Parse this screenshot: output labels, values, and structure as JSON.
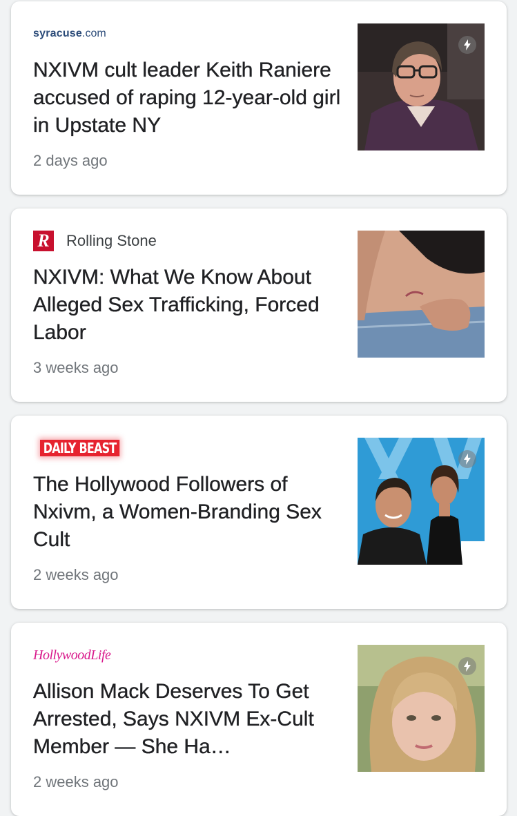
{
  "articles": [
    {
      "source": "syracuse",
      "source_suffix": ".com",
      "headline": "NXIVM cult leader Keith Raniere accused of raping 12-year-old girl in Upstate NY",
      "time": "2 days ago",
      "amp": true
    },
    {
      "logo_letter": "R",
      "source": "Rolling Stone",
      "headline": "NXIVM: What We Know About Alleged Sex Trafficking, Forced Labor",
      "time": "3 weeks ago",
      "amp": false
    },
    {
      "source": "DAILY BEAST",
      "headline": "The Hollywood Followers of Nxivm, a Women-Branding Sex Cult",
      "time": "2 weeks ago",
      "amp": true
    },
    {
      "source": "HollywoodLife",
      "headline": "Allison Mack Deserves To Get Arrested, Says NXIVM Ex-Cult Member — She Ha…",
      "time": "2 weeks ago",
      "amp": true
    }
  ],
  "colors": {
    "page_bg": "#f1f3f4",
    "headline": "#202124",
    "timestamp": "#70757a",
    "syracuse_logo": "#2a4a78",
    "rolling_stone_logo": "#c8102e",
    "daily_beast_logo": "#e6232f",
    "hollywood_life_logo": "#d91a8c"
  },
  "icons": [
    "amp-lightning-icon"
  ]
}
